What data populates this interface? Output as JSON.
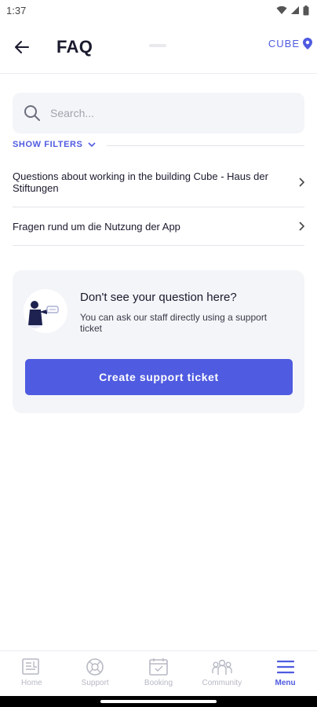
{
  "statusbar": {
    "time": "1:37"
  },
  "header": {
    "title": "FAQ",
    "location": "CUBE"
  },
  "search": {
    "placeholder": "Search..."
  },
  "filters": {
    "label": "SHOW FILTERS"
  },
  "faq": [
    {
      "label": "Questions about working in the building Cube - Haus der Stiftungen"
    },
    {
      "label": "Fragen rund um die Nutzung der App"
    }
  ],
  "support": {
    "title": "Don't see your question here?",
    "subtitle": "You can ask our staff directly using a support ticket",
    "button": "Create support ticket"
  },
  "nav": [
    {
      "label": "Home",
      "icon": "home-icon"
    },
    {
      "label": "Support",
      "icon": "support-icon"
    },
    {
      "label": "Booking",
      "icon": "calendar-icon"
    },
    {
      "label": "Community",
      "icon": "community-icon"
    },
    {
      "label": "Menu",
      "icon": "menu-icon",
      "active": true
    }
  ],
  "colors": {
    "accent": "#4f5be0",
    "card_bg": "#f4f5f8",
    "text": "#1a1a2e",
    "nav_inactive": "#b7b9c4"
  }
}
